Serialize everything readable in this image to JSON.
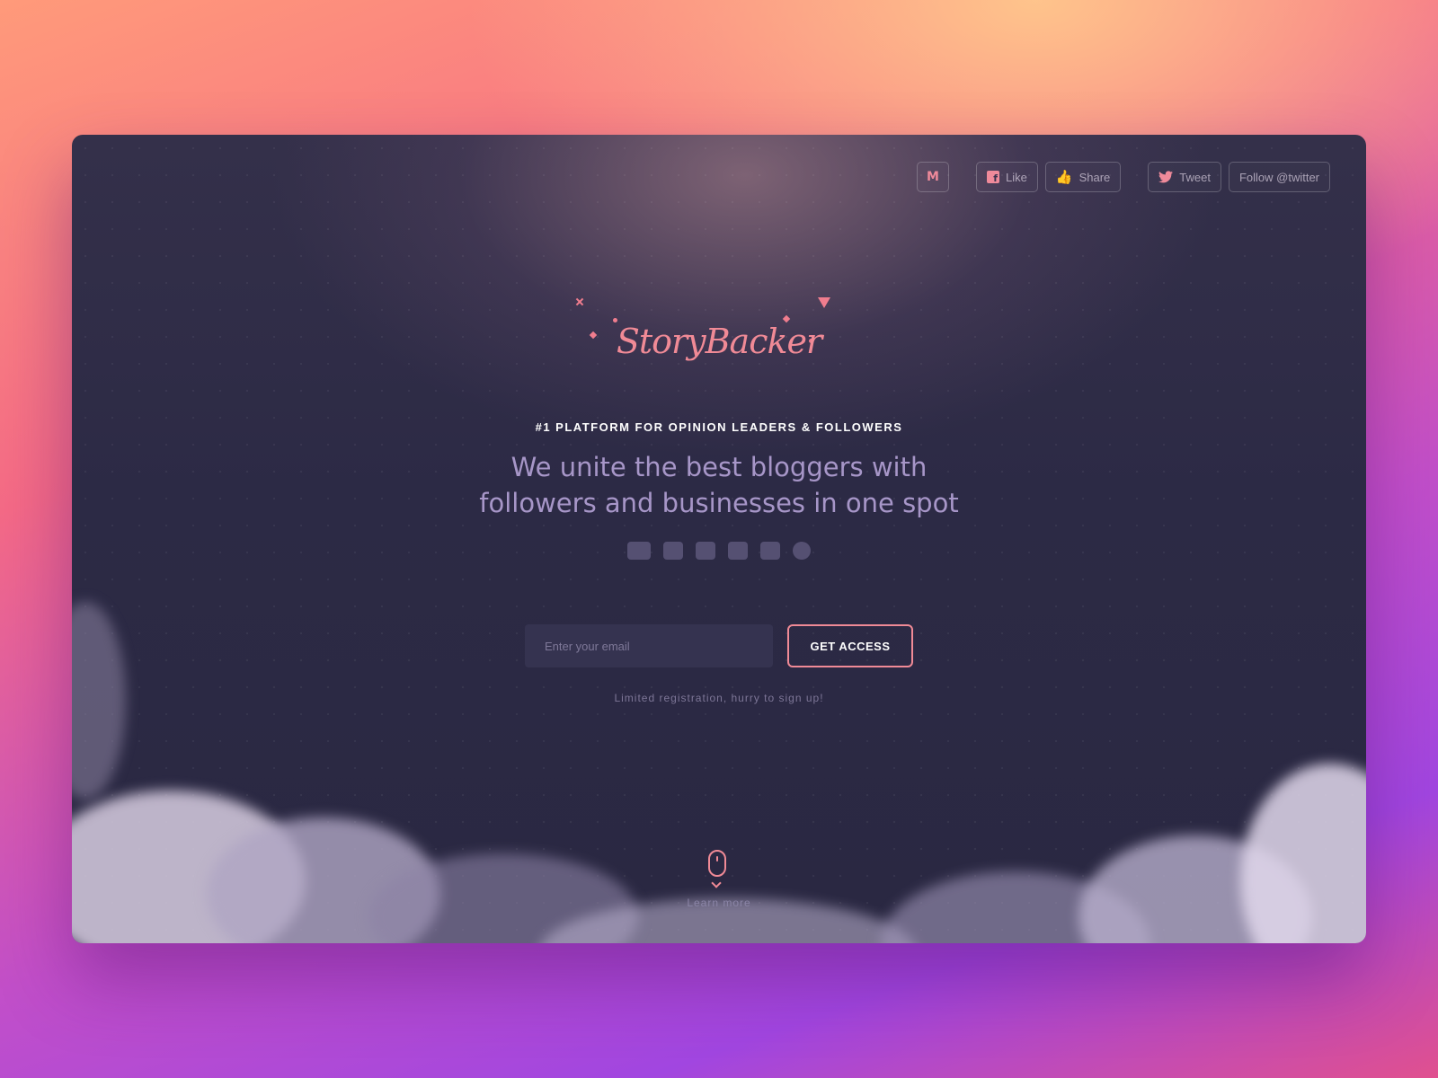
{
  "topbar": {
    "medium_icon": "medium-icon",
    "like_label": "Like",
    "share_label": "Share",
    "tweet_label": "Tweet",
    "follow_label": "Follow @twitter"
  },
  "hero": {
    "logo": "StoryBacker",
    "kicker": "#1 PLATFORM FOR OPINION LEADERS & FOLLOWERS",
    "headline_line1": "We unite the best bloggers with",
    "headline_line2": "followers and businesses in one spot",
    "platform_icons": [
      "youtube-icon",
      "twitter-icon",
      "facebook-icon",
      "medium-icon",
      "instagram-icon",
      "wordpress-icon"
    ]
  },
  "signup": {
    "email_placeholder": "Enter your email",
    "cta_label": "GET ACCESS",
    "note": "Limited registration, hurry to sign up!"
  },
  "footer": {
    "learn_more": "Learn more"
  },
  "colors": {
    "accent": "#f08a96",
    "card_bg": "#2c2a45",
    "headline": "#a796c8"
  }
}
